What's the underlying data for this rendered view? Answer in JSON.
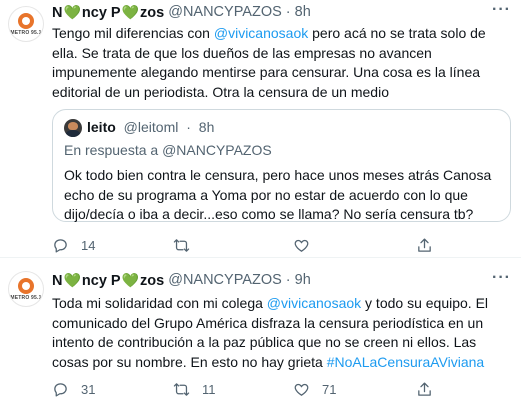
{
  "tweets": [
    {
      "avatar_logo_text": "METRO 95.1",
      "author_name_a": "N",
      "author_name_b": "ncy P",
      "author_name_c": "zos",
      "heart_glyph": "💚",
      "handle": "@NANCYPAZOS",
      "dot": "·",
      "time": "8h",
      "text_before_link": "Tengo mil diferencias con ",
      "mention": "@vivicanosaok",
      "text_after_link": " pero acá no se trata solo de ella. Se trata de que los dueños de las empresas no avancen impunemente alegando mentirse para censurar. Una cosa es la línea editorial de un periodista. Otra la censura de un medio",
      "quote": {
        "name": "leito",
        "handle": "@leitoml",
        "dot": "·",
        "time": "8h",
        "reply_prefix": "En respuesta a ",
        "reply_handle": "@NANCYPAZOS",
        "text": "Ok todo bien contra le censura, pero hace unos meses atrás Canosa echo de su programa a Yoma por no estar de acuerdo con lo que dijo/decía o iba a decir...eso como se llama? No sería censura tb?"
      },
      "reply_count": "14",
      "retweet_count": "",
      "like_count": ""
    },
    {
      "avatar_logo_text": "METRO 95.1",
      "author_name_a": "N",
      "author_name_b": "ncy P",
      "author_name_c": "zos",
      "heart_glyph": "💚",
      "handle": "@NANCYPAZOS",
      "dot": "·",
      "time": "9h",
      "text_before_link": "Toda mi solidaridad con mi colega ",
      "mention": "@vivicanosaok",
      "text_middle": " y todo su equipo. El comunicado del Grupo América disfraza la censura periodística en un intento de contribución a la paz pública que no se creen ni ellos. Las cosas por su nombre. En esto no hay grieta ",
      "hashtag": "#NoALaCensuraAViviana",
      "reply_count": "31",
      "retweet_count": "11",
      "like_count": "71"
    }
  ],
  "colors": {
    "link": "#1d9bf0",
    "muted": "#536471",
    "heart": "#78b13f",
    "logo": "#e8742b"
  },
  "icons": [
    "more-icon",
    "reply-icon",
    "retweet-icon",
    "like-icon",
    "share-icon"
  ]
}
